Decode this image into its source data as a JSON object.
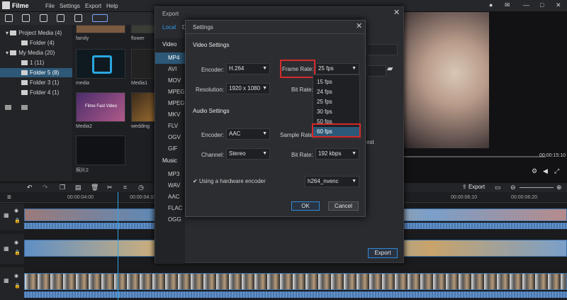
{
  "app": {
    "name": "Filme"
  },
  "menu": [
    "File",
    "Settings",
    "Export",
    "Help"
  ],
  "tree": [
    {
      "label": "Project Media (4)"
    },
    {
      "label": "Folder (4)"
    },
    {
      "label": "My Media (20)"
    },
    {
      "label": "1 (11)"
    },
    {
      "label": "Folder 5 (8)"
    },
    {
      "label": "Folder 3 (1)"
    },
    {
      "label": "Folder 4 (1)"
    }
  ],
  "media": {
    "items": [
      "family",
      "flower",
      "media",
      "Media1",
      "Media2",
      "wedding",
      "照片2"
    ],
    "thumb_caption": "Filme Fast Video"
  },
  "preview": {
    "time": "00:00:15:10"
  },
  "toolbar": {
    "export_label": "Export"
  },
  "ruler": {
    "ticks": [
      "00:00:04:00",
      "00:00:04:10",
      "00:00:06:10",
      "00:00:06:20"
    ]
  },
  "outer_dialog": {
    "title": "Export",
    "tabs": [
      "Local",
      "D"
    ],
    "video_header": "Video",
    "video_formats": [
      "MP4",
      "AVI",
      "MOV",
      "MPEG",
      "MPEG",
      "MKV",
      "FLV",
      "OGV",
      "GIF"
    ],
    "music_header": "Music",
    "music_formats": [
      "MP3",
      "WAV",
      "AAC",
      "FLAC",
      "OGG"
    ],
    "peek_text": "est",
    "export_button": "Export"
  },
  "settings": {
    "title": "Settings",
    "video_section": "Video Settings",
    "encoder_label": "Encoder:",
    "encoder_value": "H.264",
    "frame_rate_label": "Frame Rate:",
    "frame_rate_value": "25 fps",
    "resolution_label": "Resolution:",
    "resolution_value": "1920 x 1080",
    "bitrate_label": "Bit Rate:",
    "audio_section": "Audio Settings",
    "audio_encoder_label": "Encoder:",
    "audio_encoder_value": "AAC",
    "sample_rate_label": "Sample Rate:",
    "channel_label": "Channel:",
    "channel_value": "Stereo",
    "audio_bitrate_label": "Bit Rate:",
    "audio_bitrate_value": "192 kbps",
    "hw_label": "Using a hardware encoder",
    "hw_value": "h264_nvenc",
    "ok": "OK",
    "cancel": "Cancel"
  },
  "frame_rate_options": [
    "15 fps",
    "24 fps",
    "25 fps",
    "30 fps",
    "50 fps",
    "60 fps"
  ],
  "colors": {
    "accent": "#2d5877",
    "highlight": "#d42a2a",
    "playhead": "#2fa3e6"
  }
}
